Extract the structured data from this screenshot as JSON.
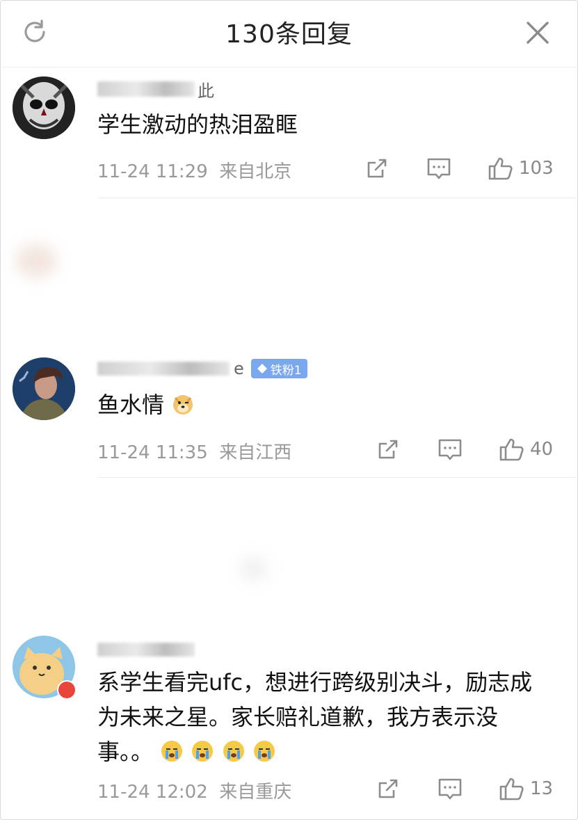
{
  "header": {
    "title": "130条回复"
  },
  "comments": [
    {
      "name_visible": "此",
      "text": "学生激动的热泪盈眶",
      "meta": "11-24 11:29  来自北京",
      "likes": "103"
    },
    {
      "name_visible": "e",
      "badge": "铁粉1",
      "text": "鱼水情",
      "meta": "11-24 11:35  来自江西",
      "likes": "40"
    },
    {
      "name_visible": "",
      "text": "系学生看完ufc，想进行跨级别决斗，励志成为未来之星。家长赔礼道歉，我方表示没事。。",
      "meta": "11-24 12:02  来自重庆",
      "likes": "13"
    }
  ],
  "icons": {
    "refresh": "refresh-icon",
    "close": "close-icon",
    "share": "share-icon",
    "comment": "comment-icon",
    "like": "like-icon"
  },
  "colors": {
    "badge": "#7aa7ee",
    "meta": "#999999"
  }
}
